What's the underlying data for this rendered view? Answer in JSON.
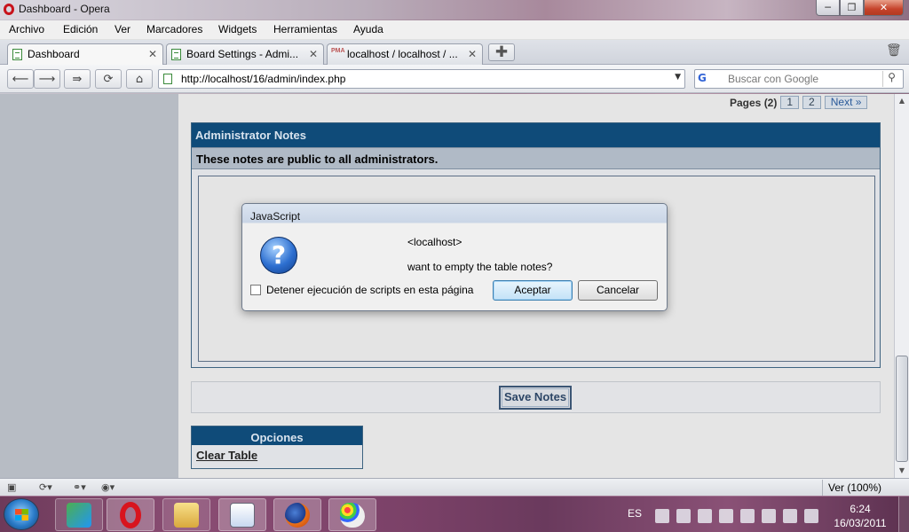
{
  "window": {
    "title": "Dashboard - Opera",
    "min_glyph": "─",
    "max_glyph": "❐",
    "close_glyph": "✕"
  },
  "menu": [
    "Archivo",
    "Edición",
    "Ver",
    "Marcadores",
    "Widgets",
    "Herramientas",
    "Ayuda"
  ],
  "tabs": [
    {
      "label": "Dashboard",
      "close": "✕"
    },
    {
      "label": "Board Settings - Admi...",
      "close": "✕"
    },
    {
      "label": "localhost / localhost / ...",
      "close": "✕",
      "favicon_text": "PMA"
    }
  ],
  "newtab_glyph": "✚",
  "address": {
    "url": "http://localhost/16/admin/index.php",
    "dropdown_glyph": "▼"
  },
  "search": {
    "placeholder": "Buscar con Google",
    "engine_glyph": "G",
    "button_glyph": "⚲"
  },
  "nav_glyphs": {
    "back": "⟵",
    "forward": "⟶",
    "fastforward": "⇛",
    "reload": "⟳",
    "home": "⌂"
  },
  "pagination": {
    "label": "Pages (2)",
    "page1": "1",
    "page2": "2",
    "next": "Next »"
  },
  "notes_panel": {
    "title": "Administrator Notes",
    "subtitle": "These notes are public to all administrators."
  },
  "save_button": "Save Notes",
  "options_panel": {
    "title": "Opciones",
    "link": "Clear Table"
  },
  "dialog": {
    "title": "JavaScript",
    "icon_glyph": "?",
    "host": "<localhost>",
    "message": "want to empty the table notes?",
    "checkbox_label": "Detener ejecución de scripts en esta página",
    "accept": "Aceptar",
    "cancel": "Cancelar"
  },
  "statusbar": {
    "zoom": "Ver (100%)"
  },
  "taskbar": {
    "apps": [
      "people",
      "opera",
      "explorer",
      "notepad",
      "firefox",
      "paint"
    ],
    "language": "ES",
    "time": "6:24",
    "date": "16/03/2011"
  },
  "colors": {
    "panel_header": "#0f4b79",
    "subheader": "#b0bac6",
    "page_bg": "#e5e5e5",
    "viewport_bg": "#b7bcc4"
  }
}
